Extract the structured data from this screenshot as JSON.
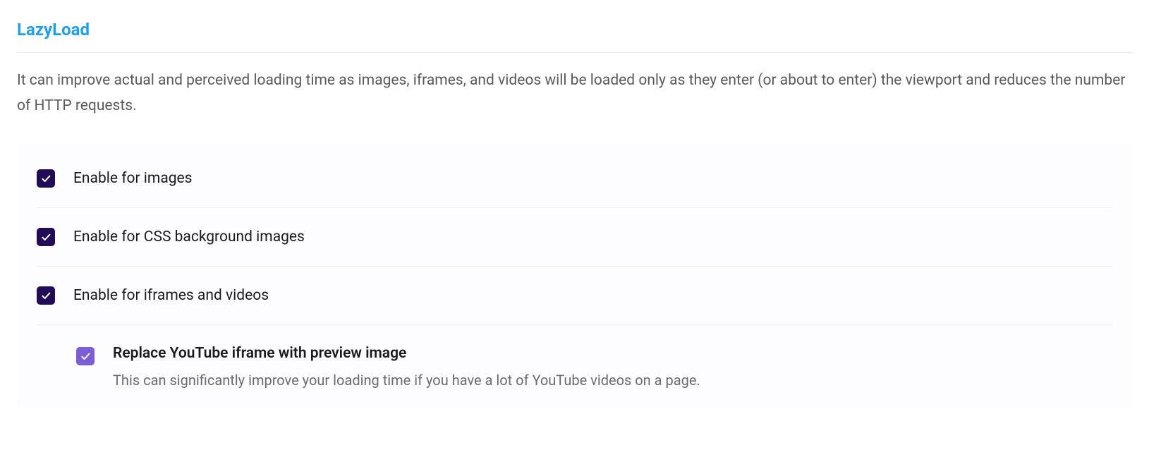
{
  "section": {
    "title": "LazyLoad",
    "description": "It can improve actual and perceived loading time as images, iframes, and videos will be loaded only as they enter (or about to enter) the viewport and reduces the number of HTTP requests."
  },
  "options": {
    "enable_images": {
      "label": "Enable for images",
      "checked": true
    },
    "enable_css_bg": {
      "label": "Enable for CSS background images",
      "checked": true
    },
    "enable_iframes": {
      "label": "Enable for iframes and videos",
      "checked": true
    },
    "replace_youtube": {
      "label": "Replace YouTube iframe with preview image",
      "description": "This can significantly improve your loading time if you have a lot of YouTube videos on a page.",
      "checked": true
    }
  }
}
